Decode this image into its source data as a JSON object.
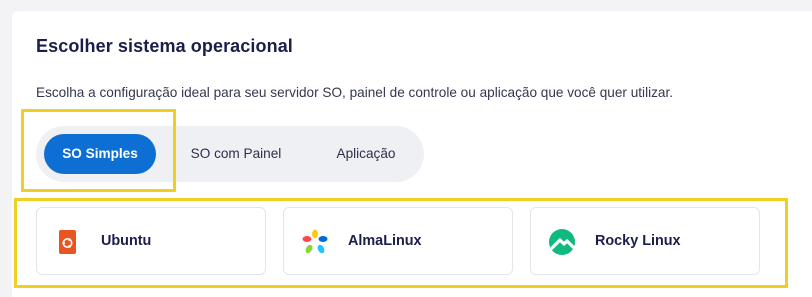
{
  "section": {
    "title": "Escolher sistema operacional",
    "subtitle": "Escolha a configuração ideal para seu servidor SO, painel de controle ou aplicação que você quer utilizar."
  },
  "tabs": [
    {
      "label": "SO Simples",
      "active": true
    },
    {
      "label": "SO com Painel",
      "active": false
    },
    {
      "label": "Aplicação",
      "active": false
    }
  ],
  "os_options": [
    {
      "name": "Ubuntu",
      "icon": "ubuntu-icon"
    },
    {
      "name": "AlmaLinux",
      "icon": "almalinux-icon"
    },
    {
      "name": "Rocky Linux",
      "icon": "rocky-linux-icon"
    }
  ],
  "colors": {
    "accent": "#0d6fd3",
    "highlight": "#f0cf22",
    "ubuntu": "#e95420",
    "rocky": "#10b981"
  }
}
